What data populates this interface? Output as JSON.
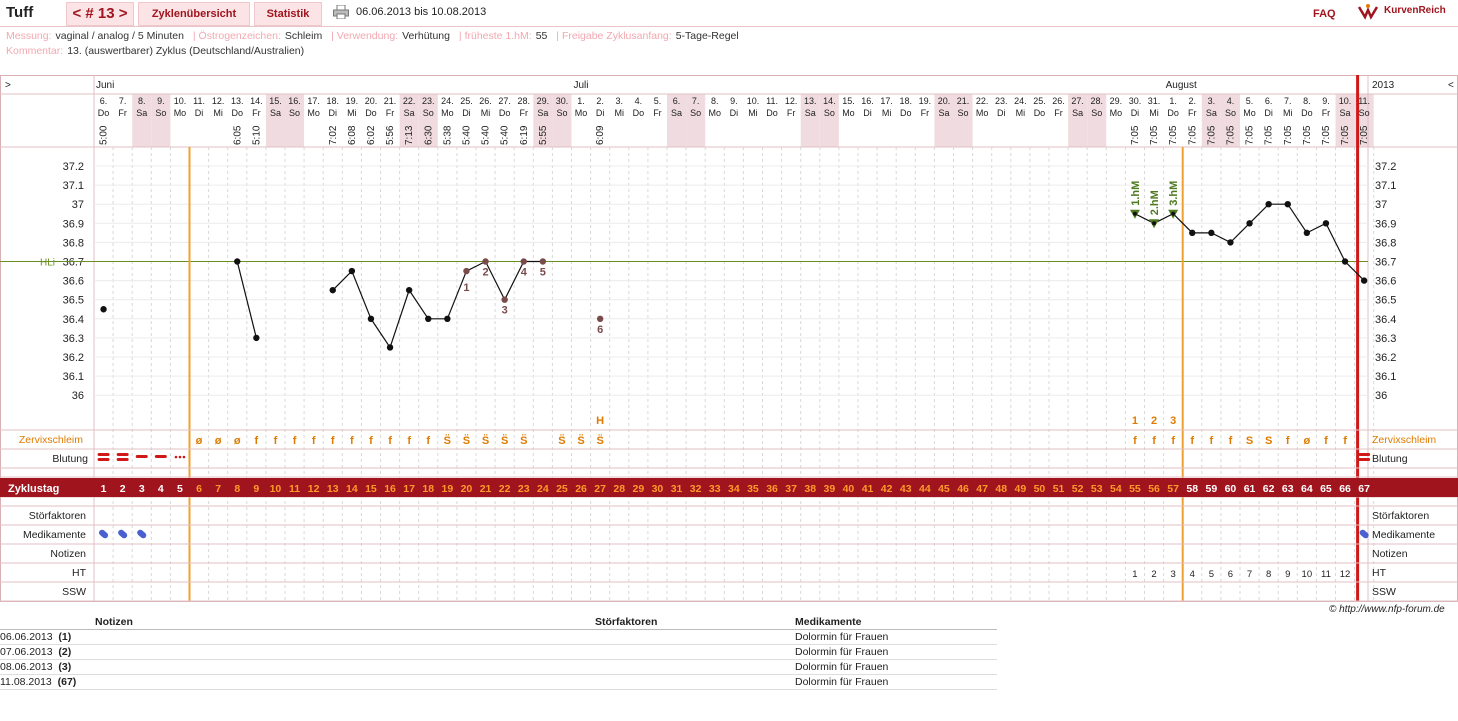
{
  "header": {
    "title": "Tuff",
    "cycle_nav": "< # 13 >",
    "tab_overview": "Zyklenübersicht",
    "tab_stats": "Statistik",
    "print_icon": "printer-icon",
    "date_range": "06.06.2013 bis 10.08.2013",
    "faq": "FAQ",
    "brand": "KurvenReich",
    "brand_icon": "kurvenreich-logo-icon"
  },
  "info": {
    "messung_label": "Messung:",
    "messung": "vaginal / analog / 5 Minuten",
    "oestrogen_label": "Östrogenzeichen:",
    "oestrogen": "Schleim",
    "verwendung_label": "Verwendung:",
    "verwendung": "Verhütung",
    "frueheste_label": "früheste 1.hM:",
    "frueheste": "55",
    "freigabe_label": "Freigabe Zyklusanfang:",
    "freigabe": "5-Tage-Regel",
    "kommentar_label": "Kommentar:",
    "kommentar": "13. (auswertbarer) Zyklus (Deutschland/Australien)"
  },
  "colors": {
    "accent": "#a0141e",
    "orange": "#e07b00",
    "weekend": "#f0dce0",
    "coverline": "#6b8e23",
    "tempmark": "#7a4b4b",
    "phase_line": "#f0a030",
    "today_line": "#d01818",
    "hm_green": "#4e7a1f"
  },
  "chart_data": {
    "type": "line",
    "title": "",
    "months": [
      {
        "label": "Juni",
        "day": 1
      },
      {
        "label": "Juli",
        "day": 26
      },
      {
        "label": "August",
        "day": 57
      }
    ],
    "year": "2013",
    "nav_left": ">",
    "nav_right": "<",
    "dates": [
      "6.",
      "7.",
      "8.",
      "9.",
      "10.",
      "11.",
      "12.",
      "13.",
      "14.",
      "15.",
      "16.",
      "17.",
      "18.",
      "19.",
      "20.",
      "21.",
      "22.",
      "23.",
      "24.",
      "25.",
      "26.",
      "27.",
      "28.",
      "29.",
      "30.",
      "1.",
      "2.",
      "3.",
      "4.",
      "5.",
      "6.",
      "7.",
      "8.",
      "9.",
      "10.",
      "11.",
      "12.",
      "13.",
      "14.",
      "15.",
      "16.",
      "17.",
      "18.",
      "19.",
      "20.",
      "21.",
      "22.",
      "23.",
      "24.",
      "25.",
      "26.",
      "27.",
      "28.",
      "29.",
      "30.",
      "31.",
      "1.",
      "2.",
      "3.",
      "4.",
      "5.",
      "6.",
      "7.",
      "8.",
      "9.",
      "10.",
      "11."
    ],
    "weekdays": [
      "Do",
      "Fr",
      "Sa",
      "So",
      "Mo",
      "Di",
      "Mi",
      "Do",
      "Fr",
      "Sa",
      "So",
      "Mo",
      "Di",
      "Mi",
      "Do",
      "Fr",
      "Sa",
      "So",
      "Mo",
      "Di",
      "Mi",
      "Do",
      "Fr",
      "Sa",
      "So",
      "Mo",
      "Di",
      "Mi",
      "Do",
      "Fr",
      "Sa",
      "So",
      "Mo",
      "Di",
      "Mi",
      "Do",
      "Fr",
      "Sa",
      "So",
      "Mo",
      "Di",
      "Mi",
      "Do",
      "Fr",
      "Sa",
      "So",
      "Mo",
      "Di",
      "Mi",
      "Do",
      "Fr",
      "Sa",
      "So",
      "Mo",
      "Di",
      "Mi",
      "Do",
      "Fr",
      "Sa",
      "So",
      "Mo",
      "Di",
      "Mi",
      "Do",
      "Fr",
      "Sa",
      "So"
    ],
    "times": [
      "5:00",
      "",
      "",
      "",
      "",
      "",
      "",
      "6:05",
      "5:10",
      "",
      "",
      "",
      "7:02",
      "6:08",
      "6:02",
      "5:56",
      "7:13",
      "6:30",
      "5:38",
      "5:40",
      "5:40",
      "5:40",
      "6:19",
      "5:55",
      "",
      "",
      "6:09",
      "",
      "",
      "",
      "",
      "",
      "",
      "",
      "",
      "",
      "",
      "",
      "",
      "",
      "",
      "",
      "",
      "",
      "",
      "",
      "",
      "",
      "",
      "",
      "",
      "",
      "",
      "",
      "7:05",
      "7:05",
      "7:05",
      "7:05",
      "7:05",
      "7:05",
      "7:05",
      "7:05",
      "7:05",
      "7:05",
      "7:05",
      "7:05",
      "7:05"
    ],
    "y_ticks": [
      "37.2",
      "37.1",
      "37",
      "36.9",
      "36.8",
      "36.7",
      "36.6",
      "36.5",
      "36.4",
      "36.3",
      "36.2",
      "36.1",
      "36"
    ],
    "ylim": [
      35.95,
      37.28
    ],
    "coverline": {
      "label": "HLi",
      "value": 36.7
    },
    "temps": [
      [
        1,
        36.45
      ],
      [
        8,
        36.7
      ],
      [
        9,
        36.3
      ],
      [
        13,
        36.55
      ],
      [
        14,
        36.65
      ],
      [
        15,
        36.4
      ],
      [
        16,
        36.25
      ],
      [
        17,
        36.55
      ],
      [
        18,
        36.4
      ],
      [
        19,
        36.4
      ],
      [
        20,
        36.65
      ],
      [
        21,
        36.7
      ],
      [
        22,
        36.5
      ],
      [
        23,
        36.7
      ],
      [
        24,
        36.7
      ],
      [
        27,
        36.4
      ],
      [
        55,
        36.95
      ],
      [
        56,
        36.9
      ],
      [
        57,
        36.95
      ],
      [
        58,
        36.85
      ],
      [
        59,
        36.85
      ],
      [
        60,
        36.8
      ],
      [
        61,
        36.9
      ],
      [
        62,
        37.0
      ],
      [
        63,
        37.0
      ],
      [
        64,
        36.85
      ],
      [
        65,
        36.9
      ],
      [
        66,
        36.7
      ],
      [
        67,
        36.6
      ]
    ],
    "segments": [
      [
        1
      ],
      [
        8,
        9
      ],
      [
        13,
        14,
        15,
        16,
        17,
        18,
        19,
        20,
        21,
        22,
        23,
        24
      ],
      [
        27
      ],
      [
        55,
        56,
        57,
        58,
        59,
        60,
        61,
        62,
        63,
        64,
        65,
        66,
        67
      ]
    ],
    "low_labels": [
      {
        "day": 20,
        "n": "1"
      },
      {
        "day": 21,
        "n": "2"
      },
      {
        "day": 22,
        "n": "3"
      },
      {
        "day": 23,
        "n": "4"
      },
      {
        "day": 24,
        "n": "5"
      },
      {
        "day": 27,
        "n": "6"
      }
    ],
    "hm_labels": [
      {
        "day": 55,
        "label": "1.hM"
      },
      {
        "day": 56,
        "label": "2.hM"
      },
      {
        "day": 57,
        "label": "3.hM"
      }
    ],
    "peak_row": [
      {
        "day": 27,
        "t": "H"
      },
      {
        "day": 55,
        "t": "1"
      },
      {
        "day": 56,
        "t": "2"
      },
      {
        "day": 57,
        "t": "3"
      }
    ],
    "zervix_label": "Zervixschleim",
    "zervix": {
      "6": "ø",
      "7": "ø",
      "8": "ø",
      "9": "f",
      "10": "f",
      "11": "f",
      "12": "f",
      "13": "f",
      "14": "f",
      "15": "f",
      "16": "f",
      "17": "f",
      "18": "f",
      "19": "S̈",
      "20": "S̈",
      "21": "S̈",
      "22": "S̈",
      "23": "S̈",
      "25": "S̈",
      "26": "S̈",
      "27": "S̈",
      "55": "f",
      "56": "f",
      "57": "f",
      "58": "f",
      "59": "f",
      "60": "f",
      "61": "S",
      "62": "S",
      "63": "f",
      "64": "ø",
      "65": "f",
      "66": "f"
    },
    "blutung_label": "Blutung",
    "blutung": {
      "1": "heavy",
      "2": "heavy",
      "3": "medium",
      "4": "medium",
      "5": "spotting",
      "67": "heavy"
    },
    "zyklustag_label": "Zyklustag",
    "stoer_label": "Störfaktoren",
    "medi_label": "Medikamente",
    "medi_days": [
      1,
      2,
      3,
      67
    ],
    "medi_icon": "pill-icon",
    "notizen_label": "Notizen",
    "ht_label": "HT",
    "ht": {
      "55": "1",
      "56": "2",
      "57": "3",
      "58": "4",
      "59": "5",
      "60": "6",
      "61": "7",
      "62": "8",
      "63": "9",
      "64": "10",
      "65": "11",
      "66": "12"
    },
    "ssw_label": "SSW",
    "phase_line_days": [
      5,
      57
    ],
    "today_day": 66
  },
  "notes": {
    "headers": [
      "Notizen",
      "Störfaktoren",
      "Medikamente"
    ],
    "rows": [
      {
        "date": "06.06.2013",
        "day": "(1)",
        "medi": "Dolormin für Frauen"
      },
      {
        "date": "07.06.2013",
        "day": "(2)",
        "medi": "Dolormin für Frauen"
      },
      {
        "date": "08.06.2013",
        "day": "(3)",
        "medi": "Dolormin für Frauen"
      },
      {
        "date": "11.08.2013",
        "day": "(67)",
        "medi": "Dolormin für Frauen"
      }
    ]
  },
  "copyright": "© http://www.nfp-forum.de"
}
